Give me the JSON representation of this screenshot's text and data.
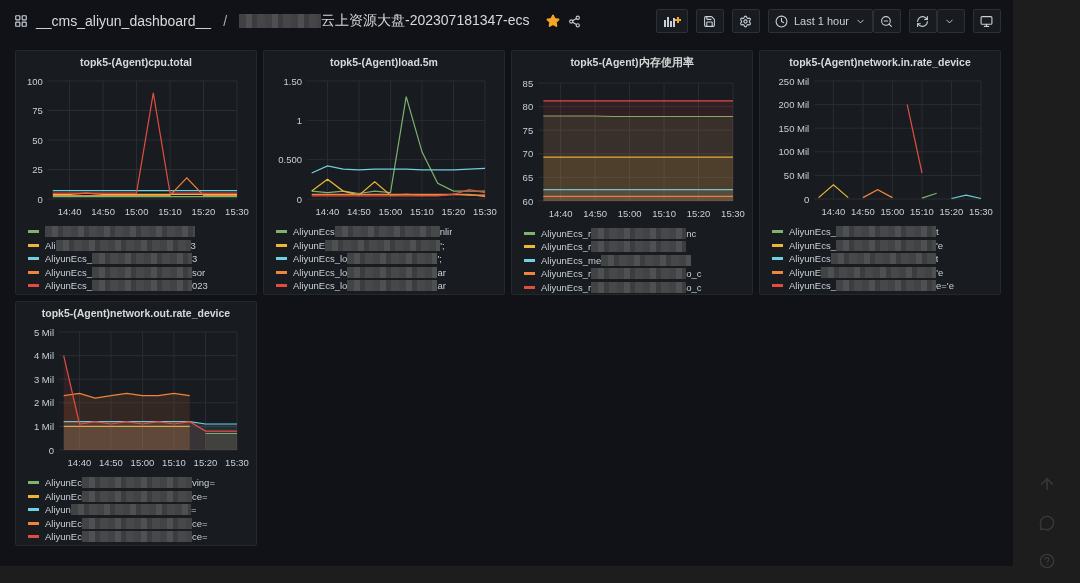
{
  "header": {
    "dashboard": "__cms_aliyun_dashboard__",
    "separator": "/",
    "title": "云上资源大盘-202307181347-ecs",
    "starred": true,
    "time_range": "Last 1 hour"
  },
  "panels": [
    {
      "title": "topk5-(Agent)cpu.total",
      "legend": [
        {
          "color": "#7eb26d"
        },
        {
          "color": "#eab839",
          "prefix": "Ali",
          "suffix": "3"
        },
        {
          "color": "#6ed0e0",
          "prefix": "AliyunEcs_",
          "suffix": "3"
        },
        {
          "color": "#ef843c",
          "prefix": "AliyunEcs_",
          "suffix": "sor"
        },
        {
          "color": "#e24d42",
          "prefix": "AliyunEcs_",
          "suffix": "023"
        }
      ],
      "chart_data": {
        "type": "line",
        "categories": [
          null,
          "14:40",
          null,
          "14:50",
          null,
          "15:00",
          null,
          "15:10",
          null,
          "15:20",
          null,
          "15:30"
        ],
        "grid": true,
        "ylim": [
          0,
          100
        ],
        "yticks": [
          0,
          25,
          50,
          75,
          100
        ],
        "series": [
          {
            "color": "#7eb26d",
            "values": [
              2,
              2,
              2,
              2,
              2,
              2,
              2,
              2,
              2,
              2,
              2,
              2
            ]
          },
          {
            "color": "#eab839",
            "values": [
              4,
              4,
              5,
              4,
              4,
              4,
              4,
              4,
              4,
              4,
              4,
              4
            ]
          },
          {
            "color": "#6ed0e0",
            "values": [
              7,
              7,
              7,
              7,
              7,
              7,
              7,
              7,
              7,
              7,
              7,
              7
            ]
          },
          {
            "color": "#ef843c",
            "values": [
              3,
              3,
              3,
              3,
              3,
              3,
              3,
              3,
              18,
              3,
              3,
              3
            ]
          },
          {
            "color": "#e24d42",
            "values": [
              5,
              5,
              5,
              5,
              5,
              5,
              90,
              5,
              5,
              5,
              5,
              5
            ]
          }
        ]
      }
    },
    {
      "title": "topk5-(Agent)load.5m",
      "legend": [
        {
          "color": "#7eb26d",
          "prefix": "AliyunEcs",
          "suffix": "nlir"
        },
        {
          "color": "#eab839",
          "prefix": "AliyunE",
          "suffix": "';"
        },
        {
          "color": "#6ed0e0",
          "prefix": "AliyunEcs_lo",
          "suffix": "';"
        },
        {
          "color": "#ef843c",
          "prefix": "AliyunEcs_lo",
          "suffix": "ar"
        },
        {
          "color": "#e24d42",
          "prefix": "AliyunEcs_lo",
          "suffix": "ar"
        }
      ],
      "chart_data": {
        "type": "line",
        "categories": [
          null,
          "14:40",
          null,
          "14:50",
          null,
          "15:00",
          null,
          "15:10",
          null,
          "15:20",
          null,
          "15:30"
        ],
        "grid": true,
        "ylim": [
          0,
          1.5
        ],
        "yticks": [
          0,
          {
            "value": 0.5,
            "label": "0.500"
          },
          1,
          {
            "value": 1.5,
            "label": "1.50"
          }
        ],
        "series": [
          {
            "color": "#7eb26d",
            "values": [
              0.1,
              0.08,
              0.1,
              0.07,
              0.1,
              0.08,
              1.3,
              0.6,
              0.2,
              0.1,
              0.1,
              0.1
            ]
          },
          {
            "color": "#eab839",
            "values": [
              0.1,
              0.25,
              0.1,
              0.05,
              0.22,
              0.05,
              0.06,
              0.05,
              0.05,
              0.06,
              0.05,
              0.05
            ]
          },
          {
            "color": "#6ed0e0",
            "values": [
              0.33,
              0.42,
              0.38,
              0.37,
              0.38,
              0.38,
              0.38,
              0.37,
              0.37,
              0.37,
              0.38,
              0.39
            ]
          },
          {
            "color": "#ef843c",
            "values": [
              0.06,
              0.06,
              0.06,
              0.06,
              0.06,
              0.06,
              0.06,
              0.06,
              0.06,
              0.06,
              0.06,
              0.03
            ]
          },
          {
            "color": "#e24d42",
            "values": [
              0.04,
              0.04,
              0.04,
              0.04,
              0.04,
              0.04,
              0.04,
              0.04,
              0.04,
              0.06,
              0.12,
              0.08
            ]
          }
        ]
      }
    },
    {
      "title": "topk5-(Agent)内存使用率",
      "legend": [
        {
          "color": "#7eb26d",
          "prefix": "AliyunEcs_r",
          "suffix": "nc"
        },
        {
          "color": "#eab839",
          "prefix": "AliyunEcs_r"
        },
        {
          "color": "#6ed0e0",
          "prefix": "AliyunEcs_me"
        },
        {
          "color": "#ef843c",
          "prefix": "AliyunEcs_r",
          "suffix": "o_c"
        },
        {
          "color": "#e24d42",
          "prefix": "AliyunEcs_r",
          "suffix": "o_c"
        }
      ],
      "chart_data": {
        "type": "area",
        "categories": [
          null,
          "14:40",
          null,
          "14:50",
          null,
          "15:00",
          null,
          "15:10",
          null,
          "15:20",
          null,
          "15:30"
        ],
        "grid": true,
        "ylim": [
          60,
          85
        ],
        "yticks": [
          60,
          65,
          70,
          75,
          80,
          85
        ],
        "series": [
          {
            "color": "#7eb26d",
            "values": [
              78,
              78,
              78,
              78,
              77.9,
              77.9,
              77.9,
              77.9,
              77.9,
              77.9,
              77.9,
              77.9
            ]
          },
          {
            "color": "#eab839",
            "values": [
              69.3,
              69.3,
              69.3,
              69.3,
              69.3,
              69.3,
              69.3,
              69.3,
              69.3,
              69.3,
              69.3,
              69.3
            ]
          },
          {
            "color": "#6ed0e0",
            "values": [
              62.4,
              62.4,
              62.4,
              62.4,
              62.4,
              62.4,
              62.4,
              62.4,
              62.4,
              62.4,
              62.4,
              62.4
            ]
          },
          {
            "color": "#ef843c",
            "values": [
              61,
              61,
              61,
              61,
              61,
              61,
              61,
              61,
              61,
              61,
              61,
              61
            ]
          },
          {
            "color": "#e24d42",
            "values": [
              81.2,
              81.2,
              81.2,
              81.2,
              81.2,
              81.2,
              81.2,
              81.2,
              81.2,
              81.2,
              81.2,
              81.2
            ]
          }
        ]
      }
    },
    {
      "title": "topk5-(Agent)network.in.rate_device",
      "legend": [
        {
          "color": "#7eb26d",
          "prefix": "AliyunEcs_",
          "suffix": "t"
        },
        {
          "color": "#eab839",
          "prefix": "AliyunEcs_",
          "suffix": "'e"
        },
        {
          "color": "#6ed0e0",
          "prefix": "AliyunEcs",
          "suffix": "t"
        },
        {
          "color": "#ef843c",
          "prefix": "AliyunE",
          "suffix": "'e"
        },
        {
          "color": "#e24d42",
          "prefix": "AliyunEcs_",
          "suffix": "e='e"
        }
      ],
      "chart_data": {
        "type": "line",
        "categories": [
          null,
          "14:40",
          null,
          "14:50",
          null,
          "15:00",
          null,
          "15:10",
          null,
          "15:20",
          null,
          "15:30"
        ],
        "grid": true,
        "ylim": [
          0,
          250
        ],
        "yticks": [
          0,
          {
            "value": 50,
            "label": "50 Mil"
          },
          {
            "value": 100,
            "label": "100 Mil"
          },
          {
            "value": 150,
            "label": "150 Mil"
          },
          {
            "value": 200,
            "label": "200 Mil"
          },
          {
            "value": 250,
            "label": "250 Mil"
          }
        ],
        "series": [
          {
            "color": "#7eb26d",
            "values": [
              null,
              null,
              null,
              null,
              null,
              null,
              null,
              2,
              12,
              null,
              null,
              null
            ]
          },
          {
            "color": "#eab839",
            "values": [
              3,
              30,
              3,
              null,
              null,
              null,
              null,
              null,
              null,
              null,
              null,
              null
            ]
          },
          {
            "color": "#6ed0e0",
            "values": [
              null,
              null,
              null,
              null,
              null,
              null,
              null,
              null,
              null,
              1,
              8,
              1
            ]
          },
          {
            "color": "#ef843c",
            "values": [
              null,
              null,
              null,
              3,
              20,
              3,
              null,
              null,
              null,
              null,
              null,
              null
            ]
          },
          {
            "color": "#e24d42",
            "values": [
              null,
              null,
              null,
              null,
              null,
              null,
              200,
              55,
              null,
              null,
              null,
              null
            ]
          }
        ]
      }
    },
    {
      "title": "topk5-(Agent)network.out.rate_device",
      "legend": [
        {
          "color": "#7eb26d",
          "prefix": "AliyunEc",
          "suffix": "ving="
        },
        {
          "color": "#eab839",
          "prefix": "AliyunEc",
          "suffix": "ce="
        },
        {
          "color": "#6ed0e0",
          "prefix": "Aliyun",
          "suffix": "="
        },
        {
          "color": "#ef843c",
          "prefix": "AliyunEc",
          "suffix": "ce="
        },
        {
          "color": "#e24d42",
          "prefix": "AliyunEc",
          "suffix": "ce="
        }
      ],
      "chart_data": {
        "type": "area",
        "categories": [
          null,
          "14:40",
          null,
          "14:50",
          null,
          "15:00",
          null,
          "15:10",
          null,
          "15:20",
          null,
          "15:30"
        ],
        "grid": true,
        "ylim": [
          0,
          5
        ],
        "yticks": [
          0,
          {
            "value": 1,
            "label": "1 Mil"
          },
          {
            "value": 2,
            "label": "2 Mil"
          },
          {
            "value": 3,
            "label": "3 Mil"
          },
          {
            "value": 4,
            "label": "4 Mil"
          },
          {
            "value": 5,
            "label": "5 Mil"
          }
        ],
        "series": [
          {
            "color": "#7eb26d",
            "values": [
              null,
              null,
              null,
              null,
              null,
              null,
              null,
              null,
              null,
              0.7,
              0.7,
              0.7
            ]
          },
          {
            "color": "#eab839",
            "values": [
              1,
              1,
              1,
              1,
              1,
              1,
              1,
              1,
              1,
              null,
              null,
              null
            ]
          },
          {
            "color": "#6ed0e0",
            "values": [
              1.2,
              1.2,
              1.2,
              1.2,
              1.2,
              1.2,
              1.2,
              1.2,
              1.2,
              1.1,
              1.1,
              1.1
            ]
          },
          {
            "color": "#ef843c",
            "values": [
              2.3,
              2.4,
              2.2,
              2.3,
              2.4,
              2.3,
              2.3,
              2.4,
              2.3,
              null,
              null,
              null
            ]
          },
          {
            "color": "#e24d42",
            "values": [
              4,
              1.1,
              1.2,
              1.1,
              1.2,
              1.1,
              1.2,
              1.1,
              1.2,
              0.8,
              0.8,
              0.8
            ]
          }
        ]
      }
    }
  ]
}
